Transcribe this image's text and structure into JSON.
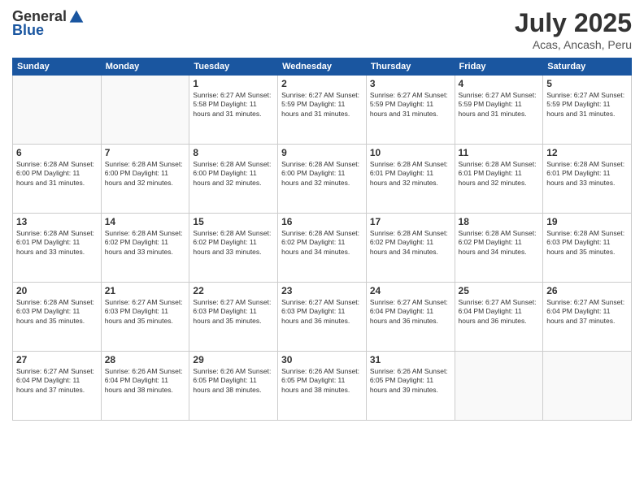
{
  "header": {
    "logo_general": "General",
    "logo_blue": "Blue",
    "month": "July 2025",
    "location": "Acas, Ancash, Peru"
  },
  "weekdays": [
    "Sunday",
    "Monday",
    "Tuesday",
    "Wednesday",
    "Thursday",
    "Friday",
    "Saturday"
  ],
  "weeks": [
    [
      {
        "day": "",
        "info": ""
      },
      {
        "day": "",
        "info": ""
      },
      {
        "day": "1",
        "info": "Sunrise: 6:27 AM\nSunset: 5:58 PM\nDaylight: 11 hours and 31 minutes."
      },
      {
        "day": "2",
        "info": "Sunrise: 6:27 AM\nSunset: 5:59 PM\nDaylight: 11 hours and 31 minutes."
      },
      {
        "day": "3",
        "info": "Sunrise: 6:27 AM\nSunset: 5:59 PM\nDaylight: 11 hours and 31 minutes."
      },
      {
        "day": "4",
        "info": "Sunrise: 6:27 AM\nSunset: 5:59 PM\nDaylight: 11 hours and 31 minutes."
      },
      {
        "day": "5",
        "info": "Sunrise: 6:27 AM\nSunset: 5:59 PM\nDaylight: 11 hours and 31 minutes."
      }
    ],
    [
      {
        "day": "6",
        "info": "Sunrise: 6:28 AM\nSunset: 6:00 PM\nDaylight: 11 hours and 31 minutes."
      },
      {
        "day": "7",
        "info": "Sunrise: 6:28 AM\nSunset: 6:00 PM\nDaylight: 11 hours and 32 minutes."
      },
      {
        "day": "8",
        "info": "Sunrise: 6:28 AM\nSunset: 6:00 PM\nDaylight: 11 hours and 32 minutes."
      },
      {
        "day": "9",
        "info": "Sunrise: 6:28 AM\nSunset: 6:00 PM\nDaylight: 11 hours and 32 minutes."
      },
      {
        "day": "10",
        "info": "Sunrise: 6:28 AM\nSunset: 6:01 PM\nDaylight: 11 hours and 32 minutes."
      },
      {
        "day": "11",
        "info": "Sunrise: 6:28 AM\nSunset: 6:01 PM\nDaylight: 11 hours and 32 minutes."
      },
      {
        "day": "12",
        "info": "Sunrise: 6:28 AM\nSunset: 6:01 PM\nDaylight: 11 hours and 33 minutes."
      }
    ],
    [
      {
        "day": "13",
        "info": "Sunrise: 6:28 AM\nSunset: 6:01 PM\nDaylight: 11 hours and 33 minutes."
      },
      {
        "day": "14",
        "info": "Sunrise: 6:28 AM\nSunset: 6:02 PM\nDaylight: 11 hours and 33 minutes."
      },
      {
        "day": "15",
        "info": "Sunrise: 6:28 AM\nSunset: 6:02 PM\nDaylight: 11 hours and 33 minutes."
      },
      {
        "day": "16",
        "info": "Sunrise: 6:28 AM\nSunset: 6:02 PM\nDaylight: 11 hours and 34 minutes."
      },
      {
        "day": "17",
        "info": "Sunrise: 6:28 AM\nSunset: 6:02 PM\nDaylight: 11 hours and 34 minutes."
      },
      {
        "day": "18",
        "info": "Sunrise: 6:28 AM\nSunset: 6:02 PM\nDaylight: 11 hours and 34 minutes."
      },
      {
        "day": "19",
        "info": "Sunrise: 6:28 AM\nSunset: 6:03 PM\nDaylight: 11 hours and 35 minutes."
      }
    ],
    [
      {
        "day": "20",
        "info": "Sunrise: 6:28 AM\nSunset: 6:03 PM\nDaylight: 11 hours and 35 minutes."
      },
      {
        "day": "21",
        "info": "Sunrise: 6:27 AM\nSunset: 6:03 PM\nDaylight: 11 hours and 35 minutes."
      },
      {
        "day": "22",
        "info": "Sunrise: 6:27 AM\nSunset: 6:03 PM\nDaylight: 11 hours and 35 minutes."
      },
      {
        "day": "23",
        "info": "Sunrise: 6:27 AM\nSunset: 6:03 PM\nDaylight: 11 hours and 36 minutes."
      },
      {
        "day": "24",
        "info": "Sunrise: 6:27 AM\nSunset: 6:04 PM\nDaylight: 11 hours and 36 minutes."
      },
      {
        "day": "25",
        "info": "Sunrise: 6:27 AM\nSunset: 6:04 PM\nDaylight: 11 hours and 36 minutes."
      },
      {
        "day": "26",
        "info": "Sunrise: 6:27 AM\nSunset: 6:04 PM\nDaylight: 11 hours and 37 minutes."
      }
    ],
    [
      {
        "day": "27",
        "info": "Sunrise: 6:27 AM\nSunset: 6:04 PM\nDaylight: 11 hours and 37 minutes."
      },
      {
        "day": "28",
        "info": "Sunrise: 6:26 AM\nSunset: 6:04 PM\nDaylight: 11 hours and 38 minutes."
      },
      {
        "day": "29",
        "info": "Sunrise: 6:26 AM\nSunset: 6:05 PM\nDaylight: 11 hours and 38 minutes."
      },
      {
        "day": "30",
        "info": "Sunrise: 6:26 AM\nSunset: 6:05 PM\nDaylight: 11 hours and 38 minutes."
      },
      {
        "day": "31",
        "info": "Sunrise: 6:26 AM\nSunset: 6:05 PM\nDaylight: 11 hours and 39 minutes."
      },
      {
        "day": "",
        "info": ""
      },
      {
        "day": "",
        "info": ""
      }
    ]
  ]
}
